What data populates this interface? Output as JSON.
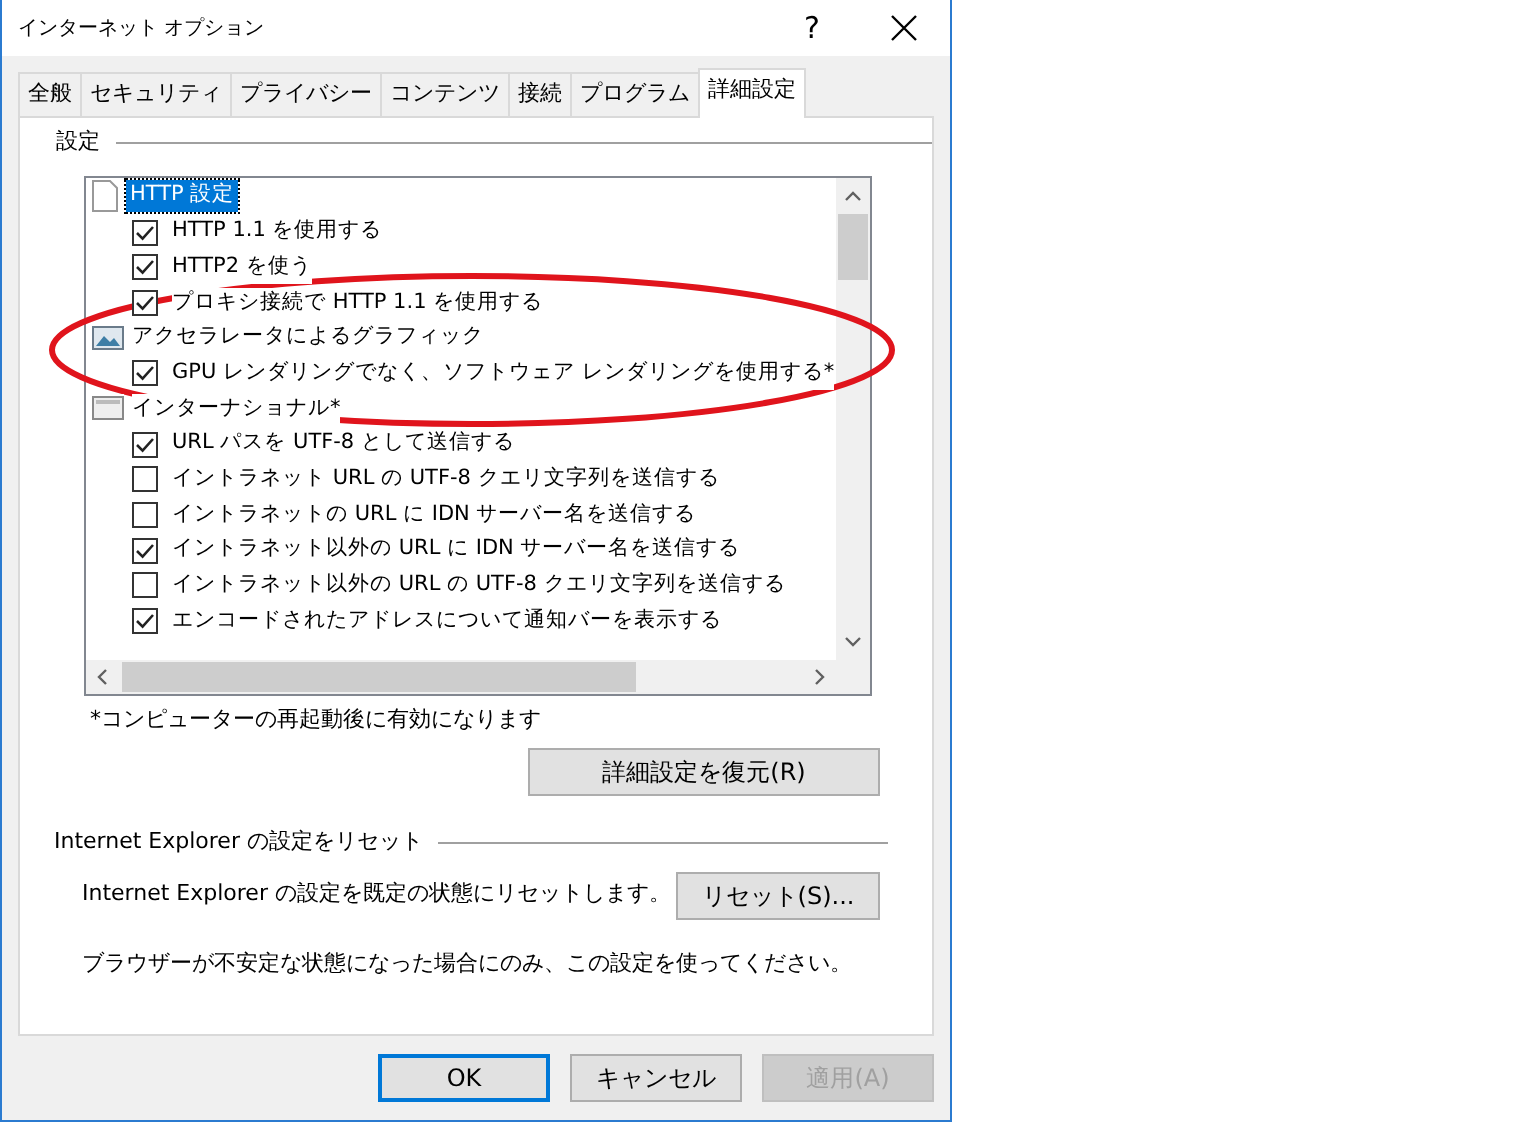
{
  "window": {
    "title": "インターネット オプション",
    "help": "?"
  },
  "tabs": [
    {
      "label": "全般",
      "selected": false
    },
    {
      "label": "セキュリティ",
      "selected": false
    },
    {
      "label": "プライバシー",
      "selected": false
    },
    {
      "label": "コンテンツ",
      "selected": false
    },
    {
      "label": "接続",
      "selected": false
    },
    {
      "label": "プログラム",
      "selected": false
    },
    {
      "label": "詳細設定",
      "selected": true
    }
  ],
  "settings": {
    "label": "設定",
    "items": [
      {
        "kind": "category",
        "label": "HTTP 設定",
        "selected": true,
        "children": [
          {
            "label": "HTTP 1.1 を使用する",
            "checked": true
          },
          {
            "label": "HTTP2 を使う",
            "checked": true
          },
          {
            "label": "プロキシ接続で HTTP 1.1 を使用する",
            "checked": true
          }
        ]
      },
      {
        "kind": "category",
        "label": "アクセラレータによるグラフィック",
        "selected": false,
        "children": [
          {
            "label": "GPU レンダリングでなく、ソフトウェア レンダリングを使用する*",
            "checked": true
          }
        ]
      },
      {
        "kind": "category",
        "label": "インターナショナル*",
        "selected": false,
        "children": [
          {
            "label": "URL パスを UTF-8 として送信する",
            "checked": true
          },
          {
            "label": "イントラネット URL の UTF-8 クエリ文字列を送信する",
            "checked": false
          },
          {
            "label": "イントラネットの URL に IDN サーバー名を送信する",
            "checked": false
          },
          {
            "label": "イントラネット以外の URL に IDN サーバー名を送信する",
            "checked": true
          },
          {
            "label": "イントラネット以外の URL の UTF-8 クエリ文字列を送信する",
            "checked": false
          },
          {
            "label": "エンコードされたアドレスについて通知バーを表示する",
            "checked": true
          }
        ]
      }
    ],
    "note": "*コンピューターの再起動後に有効になります",
    "restore_button": "詳細設定を復元(R)"
  },
  "reset": {
    "label": "Internet Explorer の設定をリセット",
    "description": "Internet Explorer の設定を既定の状態にリセットします。",
    "button": "リセット(S)...",
    "warning": "ブラウザーが不安定な状態になった場合にのみ、この設定を使ってください。"
  },
  "buttons": [
    {
      "label": "OK",
      "default": true,
      "disabled": false
    },
    {
      "label": "キャンセル",
      "default": false,
      "disabled": false
    },
    {
      "label": "適用(A)",
      "default": false,
      "disabled": true
    }
  ]
}
